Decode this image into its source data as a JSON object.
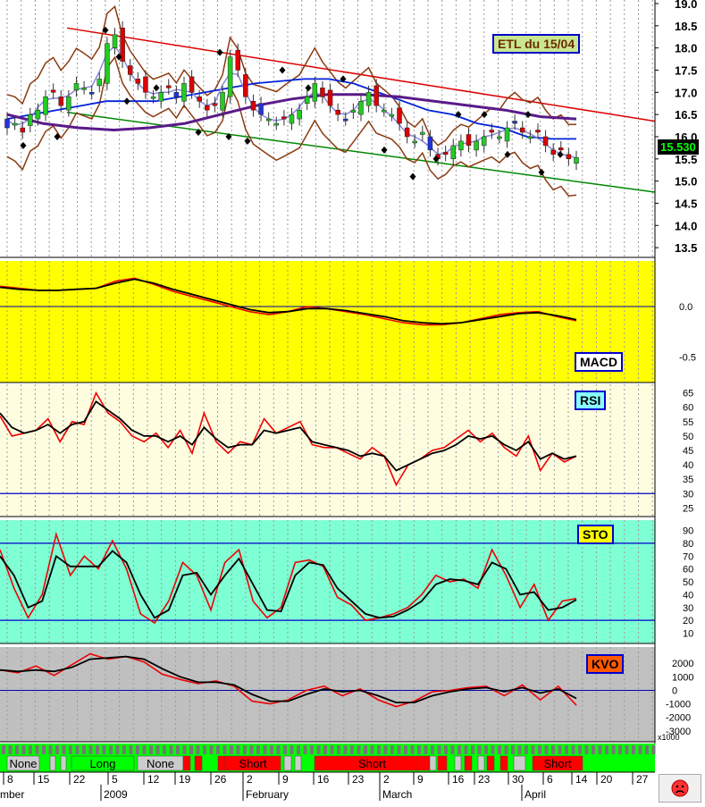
{
  "title": "ETL du 15/04",
  "last_price": "15.530",
  "face_icon": "sad-face-icon",
  "colors": {
    "price_bg": "#ffffff",
    "macd_bg": "#ffff00",
    "rsi_bg": "#fffde0",
    "sto_bg": "#7fffd4",
    "kvo_bg": "#c0c0c0",
    "signal_long": "#00ff00",
    "signal_short": "#ff0000",
    "channel_upper": "#dd0000",
    "channel_lower": "#008800"
  },
  "panels": {
    "macd": {
      "label": "MACD",
      "ticks": [
        "0.0",
        "-0.5"
      ]
    },
    "rsi": {
      "label": "RSI",
      "ticks": [
        "65",
        "60",
        "55",
        "50",
        "45",
        "40",
        "35",
        "30",
        "25"
      ]
    },
    "sto": {
      "label": "STO",
      "ticks": [
        "90",
        "80",
        "70",
        "60",
        "50",
        "40",
        "30",
        "20",
        "10"
      ]
    },
    "kvo": {
      "label": "KVO",
      "ticks": [
        "2000",
        "1000",
        "0",
        "-1000",
        "-2000",
        "-3000"
      ],
      "unit": "x1000"
    }
  },
  "signals": [
    {
      "label": "None"
    },
    {
      "label": "Long"
    },
    {
      "label": "None"
    },
    {
      "label": "Short"
    },
    {
      "label": "Short"
    },
    {
      "label": "Short"
    }
  ],
  "x_axis": {
    "days": [
      "8",
      "15",
      "22",
      "5",
      "12",
      "19",
      "26",
      "2",
      "9",
      "16",
      "23",
      "2",
      "9",
      "16",
      "23",
      "30",
      "6",
      "14",
      "20",
      "27"
    ],
    "months": [
      "mber",
      "2009",
      "February",
      "March",
      "April"
    ]
  },
  "chart_data": [
    {
      "type": "candlestick",
      "title": "ETL du 15/04",
      "ylim": [
        13.2,
        19.0
      ],
      "y_ticks": [
        "19.0",
        "18.5",
        "18.0",
        "17.5",
        "17.0",
        "16.5",
        "16.0",
        "15.5",
        "15.0",
        "14.5",
        "14.0",
        "13.5"
      ],
      "close": [
        16.4,
        16.3,
        16.1,
        16.5,
        16.6,
        16.9,
        17.0,
        16.7,
        16.9,
        17.2,
        17.1,
        17.0,
        17.3,
        18.1,
        18.3,
        17.7,
        17.4,
        17.2,
        17.0,
        16.9,
        17.0,
        17.1,
        16.9,
        17.2,
        17.0,
        16.8,
        16.6,
        16.7,
        17.0,
        17.8,
        17.5,
        16.9,
        16.6,
        16.5,
        16.4,
        16.3,
        16.4,
        16.5,
        16.6,
        16.9,
        17.2,
        16.9,
        16.7,
        16.5,
        16.4,
        16.6,
        16.8,
        17.0,
        16.7,
        16.6,
        16.5,
        16.3,
        16.0,
        15.9,
        16.1,
        15.7,
        15.5,
        15.6,
        15.8,
        15.9,
        15.8,
        15.9,
        16.0,
        16.1,
        16.0,
        16.2,
        16.3,
        16.1,
        16.0,
        16.1,
        15.8,
        15.6,
        15.7,
        15.5,
        15.53
      ],
      "ma_blue": [
        16.4,
        16.5,
        16.6,
        16.7,
        16.8,
        16.8,
        16.8,
        16.9,
        17.0,
        17.1,
        17.2,
        17.25,
        17.3,
        17.3,
        17.2,
        17.0,
        16.8,
        16.6,
        16.5,
        16.3,
        16.2,
        16.0,
        15.95,
        15.95
      ],
      "ma_purple": [
        16.5,
        16.3,
        16.2,
        16.15,
        16.2,
        16.3,
        16.5,
        16.7,
        16.85,
        16.95,
        16.95,
        16.9,
        16.8,
        16.7,
        16.6,
        16.45,
        16.4
      ],
      "channel_upper": [
        [
          0,
          18.45
        ],
        [
          1,
          16.35
        ]
      ],
      "channel_lower": [
        [
          0,
          16.55
        ],
        [
          1,
          14.75
        ]
      ]
    },
    {
      "type": "line",
      "name": "MACD",
      "ylim": [
        -0.75,
        0.45
      ],
      "series": [
        {
          "values": [
            0.2,
            0.18,
            0.16,
            0.16,
            0.17,
            0.18,
            0.25,
            0.28,
            0.22,
            0.15,
            0.1,
            0.05,
            0.0,
            -0.05,
            -0.08,
            -0.05,
            0.0,
            -0.02,
            -0.05,
            -0.08,
            -0.12,
            -0.16,
            -0.18,
            -0.18,
            -0.16,
            -0.12,
            -0.08,
            -0.06,
            -0.05,
            -0.1,
            -0.14
          ]
        },
        {
          "values": [
            0.19,
            0.17,
            0.16,
            0.16,
            0.17,
            0.18,
            0.23,
            0.27,
            0.23,
            0.17,
            0.12,
            0.07,
            0.02,
            -0.03,
            -0.06,
            -0.05,
            -0.02,
            -0.02,
            -0.04,
            -0.07,
            -0.1,
            -0.14,
            -0.16,
            -0.17,
            -0.16,
            -0.13,
            -0.1,
            -0.07,
            -0.06,
            -0.09,
            -0.13
          ]
        }
      ]
    },
    {
      "type": "line",
      "name": "RSI",
      "ylim": [
        22,
        68
      ],
      "ref_line": 30,
      "series": [
        {
          "values": [
            57,
            50,
            51,
            52,
            56,
            48,
            55,
            54,
            65,
            58,
            55,
            50,
            48,
            51,
            46,
            52,
            44,
            58,
            48,
            44,
            48,
            47,
            56,
            51,
            53,
            55,
            47,
            46,
            46,
            44,
            42,
            46,
            43,
            33,
            40,
            42,
            45,
            46,
            49,
            52,
            48,
            51,
            46,
            43,
            50,
            38,
            44,
            41,
            43
          ]
        },
        {
          "values": [
            58,
            53,
            51,
            52,
            54,
            51,
            54,
            55,
            62,
            59,
            56,
            52,
            50,
            50,
            48,
            50,
            47,
            53,
            49,
            46,
            47,
            47,
            52,
            51,
            52,
            53,
            48,
            47,
            46,
            45,
            43,
            44,
            43,
            38,
            40,
            42,
            44,
            45,
            47,
            50,
            49,
            50,
            47,
            45,
            48,
            42,
            44,
            42,
            43
          ]
        }
      ]
    },
    {
      "type": "line",
      "name": "STO",
      "ylim": [
        2,
        98
      ],
      "ref_lines": [
        20,
        80
      ],
      "series": [
        {
          "values": [
            75,
            45,
            22,
            40,
            87,
            55,
            70,
            60,
            82,
            60,
            25,
            18,
            35,
            65,
            55,
            28,
            65,
            75,
            35,
            22,
            30,
            65,
            67,
            62,
            38,
            32,
            20,
            22,
            25,
            30,
            40,
            55,
            50,
            52,
            45,
            75,
            55,
            30,
            48,
            20,
            35,
            37
          ]
        },
        {
          "values": [
            70,
            55,
            30,
            35,
            70,
            62,
            62,
            62,
            74,
            65,
            40,
            22,
            28,
            55,
            57,
            40,
            55,
            68,
            48,
            28,
            27,
            55,
            65,
            63,
            45,
            35,
            25,
            22,
            23,
            28,
            35,
            48,
            52,
            51,
            48,
            65,
            60,
            40,
            42,
            28,
            30,
            36
          ]
        }
      ]
    },
    {
      "type": "line",
      "name": "KVO",
      "ylim": [
        -3800,
        3200
      ],
      "series": [
        {
          "values": [
            1500,
            1300,
            1800,
            1100,
            1900,
            2700,
            2300,
            2500,
            2100,
            1200,
            800,
            500,
            700,
            300,
            -800,
            -1000,
            -700,
            0,
            300,
            -400,
            100,
            -700,
            -1200,
            -800,
            -100,
            0,
            200,
            300,
            -400,
            400,
            -700,
            300,
            -1100
          ]
        },
        {
          "values": [
            1500,
            1400,
            1500,
            1400,
            1700,
            2300,
            2400,
            2500,
            2300,
            1600,
            1000,
            600,
            600,
            400,
            -300,
            -800,
            -800,
            -300,
            100,
            -100,
            0,
            -400,
            -900,
            -900,
            -400,
            -100,
            100,
            200,
            -100,
            200,
            -200,
            100,
            -600
          ]
        }
      ]
    }
  ]
}
